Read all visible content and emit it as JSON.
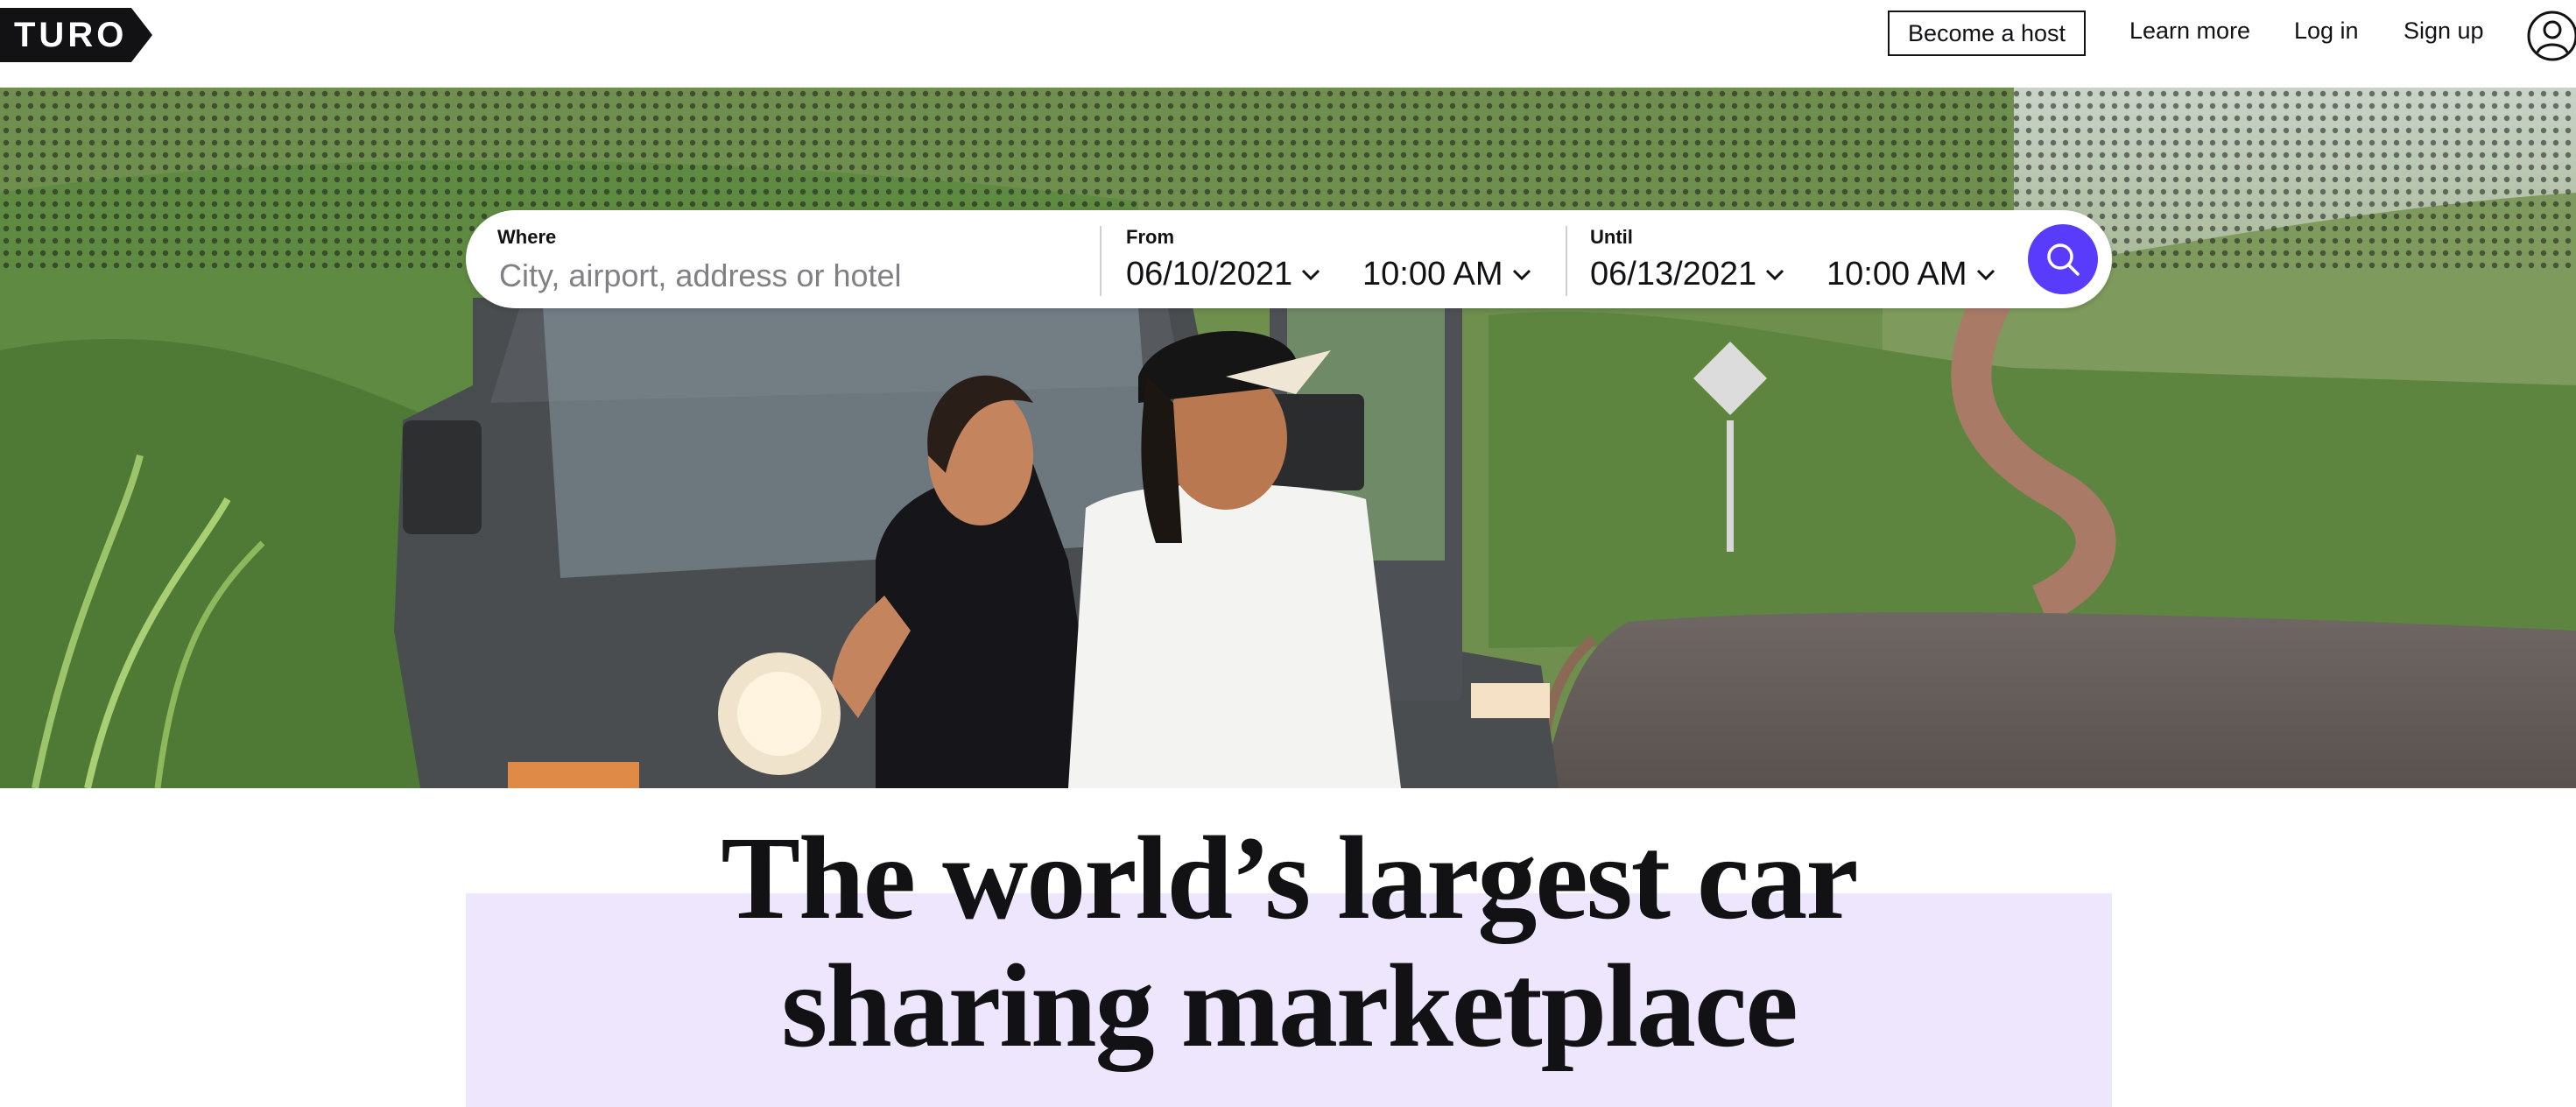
{
  "header": {
    "logo_text": "TURO",
    "become_host_label": "Become a host",
    "learn_more_label": "Learn more",
    "login_label": "Log in",
    "signup_label": "Sign up",
    "account_icon": "user-circle-icon"
  },
  "search": {
    "where_label": "Where",
    "where_placeholder": "City, airport, address or hotel",
    "from_label": "From",
    "from_date": "06/10/2021",
    "from_time": "10:00 AM",
    "until_label": "Until",
    "until_date": "06/13/2021",
    "until_time": "10:00 AM",
    "search_icon": "search-icon"
  },
  "hero": {
    "image": "couple-leaning-on-jeep-by-road"
  },
  "headline": {
    "line1": "The world’s largest car",
    "line2": "sharing marketplace"
  },
  "colors": {
    "accent": "#593cfb",
    "highlight": "#ede6fd",
    "text": "#121214"
  }
}
